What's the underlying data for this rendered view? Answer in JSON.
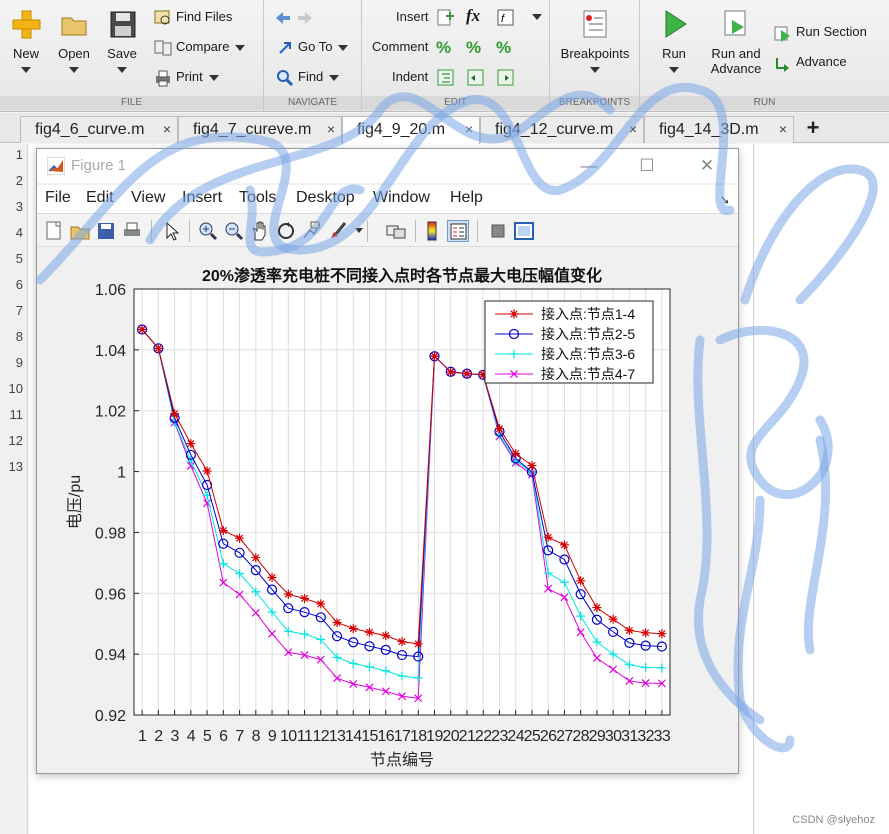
{
  "ribbon": {
    "file": {
      "label": "FILE",
      "new": "New",
      "open": "Open",
      "save": "Save",
      "find_files": "Find Files",
      "compare": "Compare",
      "print": "Print"
    },
    "navigate": {
      "label": "NAVIGATE",
      "go_to": "Go To",
      "find": "Find"
    },
    "edit": {
      "label": "EDIT",
      "insert": "Insert",
      "comment": "Comment",
      "indent": "Indent",
      "fx": "fx"
    },
    "breakpoints": {
      "label": "BREAKPOINTS",
      "breakpoints": "Breakpoints"
    },
    "run": {
      "label": "RUN",
      "run": "Run",
      "run_and_advance_1": "Run and",
      "run_and_advance_2": "Advance",
      "run_section": "Run Section",
      "advance": "Advance"
    }
  },
  "tabs": [
    {
      "label": "fig4_6_curve.m",
      "active": false
    },
    {
      "label": "fig4_7_cureve.m",
      "active": false
    },
    {
      "label": "fig4_9_20.m",
      "active": true
    },
    {
      "label": "fig4_12_curve.m",
      "active": false
    },
    {
      "label": "fig4_14_3D.m",
      "active": false
    }
  ],
  "editor": {
    "line_numbers": [
      "1",
      "2",
      "3",
      "4",
      "5",
      "6",
      "7",
      "8",
      "9",
      "10",
      "11",
      "12",
      "13"
    ],
    "watermark": "CSDN @slyehoz"
  },
  "figure": {
    "title": "Figure 1",
    "menu": [
      "File",
      "Edit",
      "View",
      "Insert",
      "Tools",
      "Desktop",
      "Window",
      "Help"
    ],
    "colors": {
      "s1": "#d40000",
      "s2": "#0000c8",
      "s3": "#00e5e5",
      "s4": "#e000e0"
    }
  },
  "chart_data": {
    "type": "line",
    "title": "20%渗透率充电桩不同接入点时各节点最大电压幅值变化",
    "xlabel": "节点编号",
    "ylabel": "电压/pu",
    "xlim": [
      0.5,
      33.5
    ],
    "ylim": [
      0.92,
      1.06
    ],
    "yticks": [
      "0.92",
      "0.94",
      "0.96",
      "0.98",
      "1",
      "1.02",
      "1.04",
      "1.06"
    ],
    "x": [
      1,
      2,
      3,
      4,
      5,
      6,
      7,
      8,
      9,
      10,
      11,
      12,
      13,
      14,
      15,
      16,
      17,
      18,
      19,
      20,
      21,
      22,
      23,
      24,
      25,
      26,
      27,
      28,
      29,
      30,
      31,
      32,
      33
    ],
    "grid": true,
    "legend_position": "top-right",
    "series": [
      {
        "name": "接入点:节点1-4",
        "marker": "asterisk",
        "values": [
          1.0467,
          1.0405,
          1.019,
          1.0092,
          1.0002,
          0.9806,
          0.9781,
          0.9717,
          0.9652,
          0.9597,
          0.9583,
          0.9565,
          0.9504,
          0.9484,
          0.9472,
          0.9461,
          0.9441,
          0.9434,
          1.0379,
          1.0328,
          1.0322,
          1.0319,
          1.0141,
          1.0059,
          1.002,
          0.9784,
          0.9759,
          0.9641,
          0.9553,
          0.9515,
          0.9478,
          0.947,
          0.9467
        ]
      },
      {
        "name": "接入点:节点2-5",
        "marker": "circle",
        "values": [
          1.0467,
          1.0405,
          1.0176,
          1.0055,
          0.9956,
          0.9763,
          0.9733,
          0.9676,
          0.9612,
          0.9551,
          0.9538,
          0.9521,
          0.9459,
          0.9439,
          0.9426,
          0.9414,
          0.9397,
          0.9392,
          1.0379,
          1.0328,
          1.0322,
          1.0318,
          1.0131,
          1.0043,
          0.9999,
          0.9741,
          0.9711,
          0.9597,
          0.9513,
          0.9473,
          0.9437,
          0.9428,
          0.9425
        ]
      },
      {
        "name": "接入点:节点3-6",
        "marker": "plus",
        "values": [
          1.0467,
          1.0405,
          1.0163,
          1.0035,
          0.9922,
          0.9697,
          0.9665,
          0.9605,
          0.9538,
          0.9475,
          0.9466,
          0.9448,
          0.9389,
          0.9369,
          0.9358,
          0.9345,
          0.9328,
          0.9322,
          1.0379,
          1.0328,
          1.0321,
          1.0318,
          1.0121,
          1.0034,
          0.9998,
          0.9666,
          0.9636,
          0.9525,
          0.944,
          0.94,
          0.9365,
          0.9356,
          0.9355
        ]
      },
      {
        "name": "接入点:节点4-7",
        "marker": "x",
        "values": [
          1.0467,
          1.0405,
          1.0161,
          1.0019,
          0.9896,
          0.9635,
          0.9596,
          0.9536,
          0.9467,
          0.9406,
          0.9397,
          0.9382,
          0.9321,
          0.9302,
          0.9291,
          0.9278,
          0.9262,
          0.9255,
          1.0379,
          1.0327,
          1.0321,
          1.0318,
          1.0115,
          1.0029,
          0.999,
          0.9615,
          0.9587,
          0.9472,
          0.9387,
          0.935,
          0.9312,
          0.9305,
          0.9304
        ]
      }
    ]
  }
}
